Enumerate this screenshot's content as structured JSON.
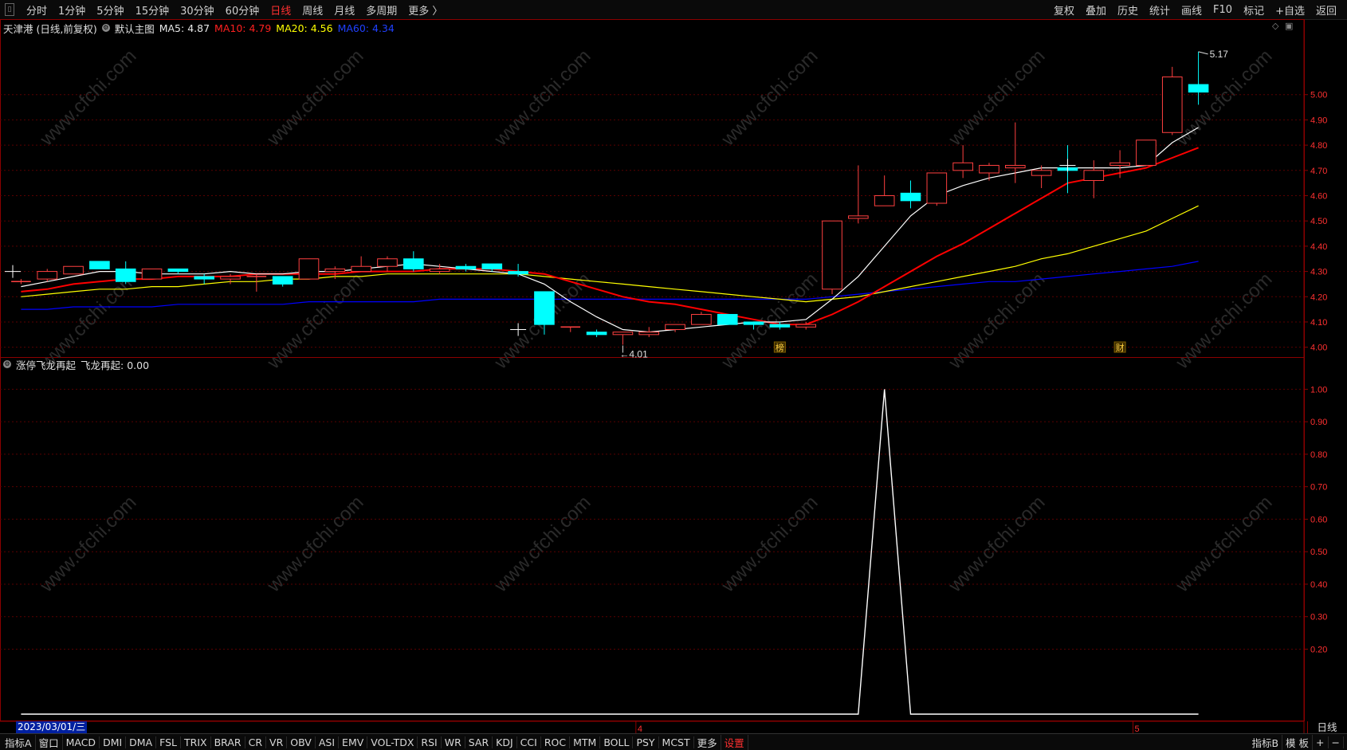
{
  "topbar": {
    "left": [
      "分时",
      "1分钟",
      "5分钟",
      "15分钟",
      "30分钟",
      "60分钟",
      "日线",
      "周线",
      "月线",
      "多周期",
      "更多 〉"
    ],
    "active": "日线",
    "right": [
      "复权",
      "叠加",
      "历史",
      "统计",
      "画线",
      "F10",
      "标记",
      "+自选",
      "返回"
    ]
  },
  "info": {
    "stock": "天津港 (日线,前复权)",
    "main": "默认主图",
    "ma5": "MA5: 4.87",
    "ma10": "MA10: 4.79",
    "ma20": "MA20: 4.56",
    "ma60": "MA60: 4.34"
  },
  "indicator": {
    "name": "涨停飞龙再起",
    "value": "飞龙再起: 0.00"
  },
  "price_labels": [
    "5.00",
    "4.90",
    "4.80",
    "4.70",
    "4.60",
    "4.50",
    "4.40",
    "4.30",
    "4.20",
    "4.10",
    "4.00"
  ],
  "ind_labels": [
    "1.00",
    "0.90",
    "0.80",
    "0.70",
    "0.60",
    "0.50",
    "0.40",
    "0.30",
    "0.20"
  ],
  "annotations": {
    "high": "5.17",
    "low": "4.01",
    "tag1": "榜",
    "tag2": "财"
  },
  "time_axis": {
    "date": "2023/03/01/三",
    "m4": "4",
    "m5": "5",
    "period": "日线"
  },
  "watermark": "www.cfchi.com",
  "colors": {
    "up": "#ff4040",
    "down": "#00ffff",
    "ma5": "#ffffff",
    "ma10": "#ff0000",
    "ma20": "#ffff00",
    "ma60": "#0000ff"
  },
  "chart_data": {
    "type": "candlestick",
    "ohlc": [
      [
        4.26,
        4.27,
        4.25,
        4.26
      ],
      [
        4.27,
        4.31,
        4.26,
        4.3
      ],
      [
        4.29,
        4.32,
        4.29,
        4.32
      ],
      [
        4.34,
        4.34,
        4.31,
        4.31
      ],
      [
        4.31,
        4.34,
        4.25,
        4.26
      ],
      [
        4.27,
        4.31,
        4.27,
        4.31
      ],
      [
        4.31,
        4.31,
        4.29,
        4.3
      ],
      [
        4.28,
        4.29,
        4.25,
        4.27
      ],
      [
        4.27,
        4.29,
        4.25,
        4.28
      ],
      [
        4.28,
        4.29,
        4.22,
        4.28
      ],
      [
        4.28,
        4.28,
        4.24,
        4.25
      ],
      [
        4.27,
        4.35,
        4.27,
        4.35
      ],
      [
        4.3,
        4.32,
        4.27,
        4.31
      ],
      [
        4.3,
        4.36,
        4.3,
        4.32
      ],
      [
        4.32,
        4.36,
        4.3,
        4.35
      ],
      [
        4.35,
        4.38,
        4.3,
        4.31
      ],
      [
        4.3,
        4.33,
        4.29,
        4.31
      ],
      [
        4.32,
        4.33,
        4.3,
        4.31
      ],
      [
        4.33,
        4.33,
        4.3,
        4.31
      ],
      [
        4.3,
        4.33,
        4.28,
        4.29
      ],
      [
        4.22,
        4.22,
        4.05,
        4.09
      ],
      [
        4.08,
        4.08,
        4.06,
        4.08
      ],
      [
        4.06,
        4.07,
        4.04,
        4.05
      ],
      [
        4.05,
        4.06,
        4.01,
        4.06
      ],
      [
        4.05,
        4.08,
        4.04,
        4.06
      ],
      [
        4.07,
        4.09,
        4.06,
        4.09
      ],
      [
        4.09,
        4.14,
        4.09,
        4.13
      ],
      [
        4.13,
        4.13,
        4.09,
        4.09
      ],
      [
        4.1,
        4.1,
        4.07,
        4.09
      ],
      [
        4.09,
        4.1,
        4.07,
        4.08
      ],
      [
        4.08,
        4.1,
        4.07,
        4.09
      ],
      [
        4.23,
        4.5,
        4.21,
        4.5
      ],
      [
        4.51,
        4.72,
        4.49,
        4.52
      ],
      [
        4.56,
        4.68,
        4.56,
        4.6
      ],
      [
        4.61,
        4.66,
        4.55,
        4.58
      ],
      [
        4.57,
        4.69,
        4.56,
        4.69
      ],
      [
        4.7,
        4.8,
        4.67,
        4.73
      ],
      [
        4.69,
        4.73,
        4.66,
        4.72
      ],
      [
        4.71,
        4.89,
        4.65,
        4.72
      ],
      [
        4.68,
        4.72,
        4.63,
        4.7
      ],
      [
        4.71,
        4.8,
        4.61,
        4.7
      ],
      [
        4.66,
        4.74,
        4.59,
        4.7
      ],
      [
        4.72,
        4.78,
        4.67,
        4.73
      ],
      [
        4.72,
        4.82,
        4.72,
        4.82
      ],
      [
        4.85,
        5.11,
        4.84,
        5.07
      ],
      [
        5.04,
        5.17,
        4.96,
        5.01
      ]
    ],
    "ma5": [
      4.24,
      4.26,
      4.28,
      4.3,
      4.3,
      4.29,
      4.29,
      4.29,
      4.3,
      4.29,
      4.29,
      4.3,
      4.3,
      4.31,
      4.32,
      4.33,
      4.32,
      4.31,
      4.3,
      4.29,
      4.25,
      4.18,
      4.12,
      4.07,
      4.06,
      4.07,
      4.08,
      4.09,
      4.1,
      4.1,
      4.11,
      4.19,
      4.28,
      4.4,
      4.52,
      4.6,
      4.64,
      4.67,
      4.69,
      4.71,
      4.71,
      4.71,
      4.71,
      4.72,
      4.81,
      4.87
    ],
    "ma10": [
      4.22,
      4.23,
      4.25,
      4.26,
      4.27,
      4.27,
      4.28,
      4.28,
      4.28,
      4.29,
      4.29,
      4.29,
      4.29,
      4.3,
      4.3,
      4.3,
      4.31,
      4.31,
      4.31,
      4.3,
      4.29,
      4.26,
      4.23,
      4.2,
      4.18,
      4.17,
      4.15,
      4.13,
      4.11,
      4.09,
      4.09,
      4.13,
      4.18,
      4.24,
      4.3,
      4.36,
      4.41,
      4.47,
      4.53,
      4.59,
      4.65,
      4.67,
      4.69,
      4.71,
      4.75,
      4.79
    ],
    "ma20": [
      4.2,
      4.21,
      4.22,
      4.23,
      4.23,
      4.24,
      4.24,
      4.25,
      4.26,
      4.26,
      4.27,
      4.27,
      4.28,
      4.28,
      4.29,
      4.29,
      4.29,
      4.29,
      4.29,
      4.29,
      4.28,
      4.27,
      4.26,
      4.25,
      4.24,
      4.23,
      4.22,
      4.21,
      4.2,
      4.19,
      4.18,
      4.19,
      4.2,
      4.22,
      4.24,
      4.26,
      4.28,
      4.3,
      4.32,
      4.35,
      4.37,
      4.4,
      4.43,
      4.46,
      4.51,
      4.56
    ],
    "ma60": [
      4.15,
      4.15,
      4.16,
      4.16,
      4.16,
      4.16,
      4.17,
      4.17,
      4.17,
      4.17,
      4.17,
      4.18,
      4.18,
      4.18,
      4.18,
      4.18,
      4.19,
      4.19,
      4.19,
      4.19,
      4.19,
      4.19,
      4.19,
      4.19,
      4.19,
      4.19,
      4.19,
      4.19,
      4.19,
      4.19,
      4.19,
      4.2,
      4.21,
      4.22,
      4.23,
      4.24,
      4.25,
      4.26,
      4.26,
      4.27,
      4.28,
      4.29,
      4.3,
      4.31,
      4.32,
      4.34
    ],
    "indicator_values": [
      0,
      0,
      0,
      0,
      0,
      0,
      0,
      0,
      0,
      0,
      0,
      0,
      0,
      0,
      0,
      0,
      0,
      0,
      0,
      0,
      0,
      0,
      0,
      0,
      0,
      0,
      0,
      0,
      0,
      0,
      0,
      0,
      0,
      1,
      0,
      0,
      0,
      0,
      0,
      0,
      0,
      0,
      0,
      0,
      0,
      0
    ],
    "price_range": [
      3.98,
      5.22
    ],
    "indicator_range": [
      0,
      1.05
    ]
  }
}
